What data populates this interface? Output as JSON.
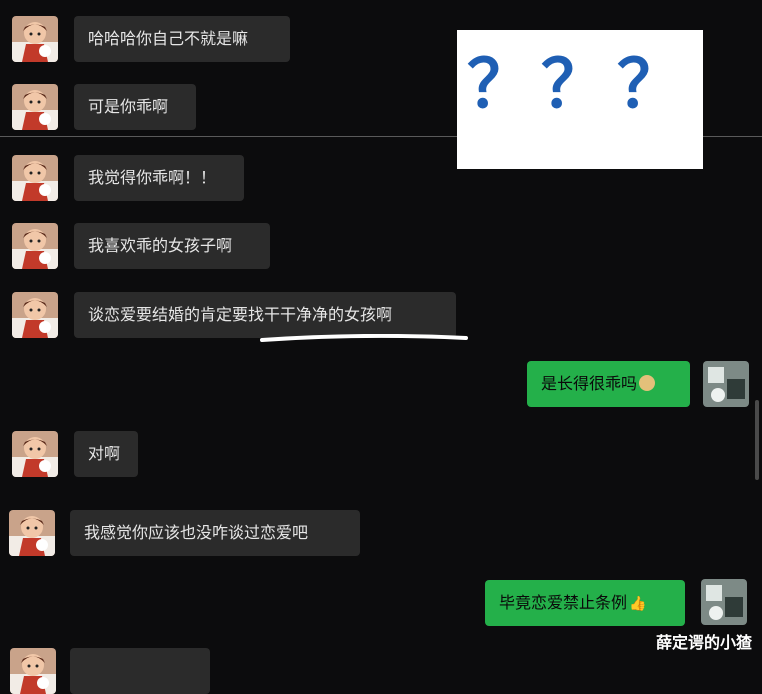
{
  "messages": [
    {
      "text": "哈哈哈你自己不就是嘛"
    },
    {
      "text": "可是你乖啊"
    },
    {
      "text": "我觉得你乖啊！！"
    },
    {
      "text": "我喜欢乖的女孩子啊"
    },
    {
      "text": "谈恋爱要结婚的肯定要找干干净净的女孩啊"
    },
    {
      "text": "是长得很乖吗"
    },
    {
      "text": "对啊"
    },
    {
      "text": "我感觉你应该也没咋谈过恋爱吧"
    },
    {
      "text": "毕竟恋爱禁止条例"
    }
  ],
  "overlay": {
    "marks": [
      "？",
      "？",
      "？"
    ]
  },
  "watermark": "薛定谔的小猹",
  "emoji_names": [
    "blushing-face-icon",
    "thumbs-up-icon"
  ]
}
